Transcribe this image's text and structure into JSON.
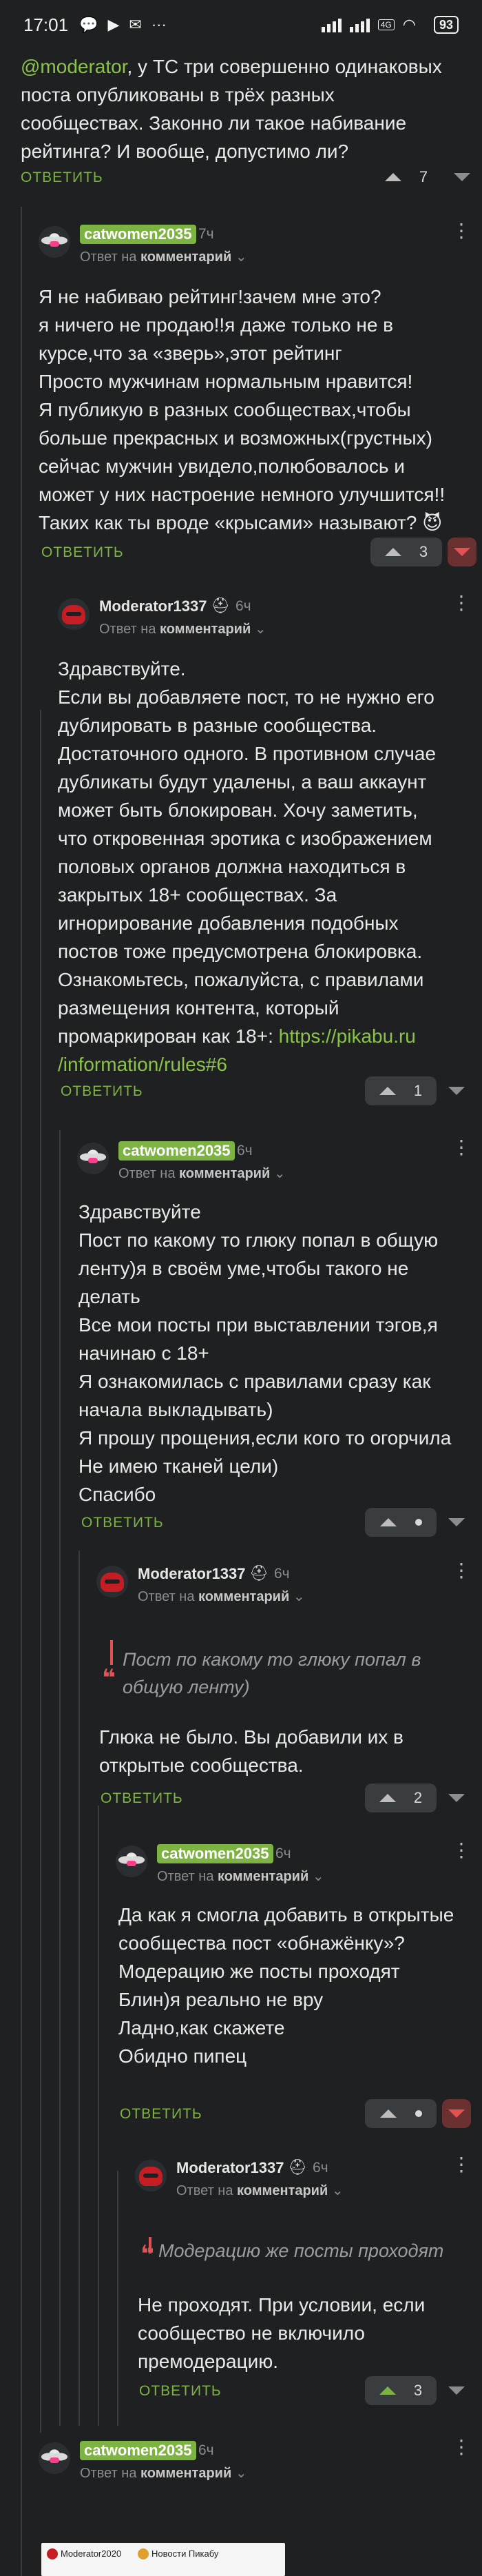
{
  "status_bar": {
    "time": "17:01",
    "icons": [
      "chat-bubble-icon",
      "youtube-icon",
      "mail-icon",
      "more-dots-icon"
    ],
    "battery": "93",
    "network": "4G"
  },
  "thread": [
    {
      "id": "intro",
      "mention": "@moderator",
      "text": ", у ТС три совершенно одинаковых поста опубликованы в трёх разных сообществах. Законно ли такое набивание рейтинга? И вообще, допустимо ли?",
      "reply_label": "ОТВЕТИТЬ",
      "rating": "7",
      "vote_state": "none"
    },
    {
      "id": "c1",
      "author": "catwomen2035",
      "time": "7ч",
      "reply_prefix": "Ответ на",
      "reply_target": "комментарий",
      "text": "Я не набиваю рейтинг!зачем мне это?\nя ничего не продаю!!я даже только не в курсе,что за «зверь»,этот рейтинг\nПросто мужчинам нормальным нравится!\nЯ публикую в разных сообществах,чтобы больше прекрасных и возможных(грустных) сейчас мужчин увидело,полюбовалось и может у них настроение немного улучшится!! Таких как ты вроде «крысами» называют? 😈",
      "reply_label": "ОТВЕТИТЬ",
      "rating": "3",
      "vote_state": "down"
    },
    {
      "id": "c2",
      "author": "Moderator1337",
      "time": "6ч",
      "reply_prefix": "Ответ на",
      "reply_target": "комментарий",
      "text": "Здравствуйте.\nЕсли вы добавляете пост, то не нужно его дублировать в разные сообщества. Достаточного одного. В противном случае дубликаты будут удалены, а ваш аккаунт может быть блокирован. Хочу заметить, что откровенная эротика с изображением половых органов должна находиться в закрытых 18+ сообществах. За игнорирование добавления подобных постов тоже предусмотрена блокировка. Ознакомьтесь, пожалуйста, с правилами размещения контента, который промаркирован как 18+: ",
      "link": "https://pikabu.ru\n/information/rules#6",
      "reply_label": "ОТВЕТИТЬ",
      "rating": "1",
      "vote_state": "none"
    },
    {
      "id": "c3",
      "author": "catwomen2035",
      "time": "6ч",
      "reply_prefix": "Ответ на",
      "reply_target": "комментарий",
      "text": "Здравствуйте\nПост по какому то глюку попал в общую ленту)я в своём уме,чтобы такого не делать\nВсе мои посты при выставлении тэгов,я начинаю с 18+\nЯ ознакомилась с правилами сразу как начала выкладывать)\nЯ прошу прощения,если кого то огорчила\nНе имею тканей цели)\nСпасибо",
      "reply_label": "ОТВЕТИТЬ",
      "rating": "•",
      "vote_state": "none"
    },
    {
      "id": "c4",
      "author": "Moderator1337",
      "time": "6ч",
      "reply_prefix": "Ответ на",
      "reply_target": "комментарий",
      "quote": "Пост по какому то глюку попал в\nобщую ленту)",
      "text": "Глюка не было. Вы добавили их в открытые сообщества.",
      "reply_label": "ОТВЕТИТЬ",
      "rating": "2",
      "vote_state": "none"
    },
    {
      "id": "c5",
      "author": "catwomen2035",
      "time": "6ч",
      "reply_prefix": "Ответ на",
      "reply_target": "комментарий",
      "text": "Да как я смогла добавить в открытые сообщества пост «обнажёнку»?\nМодерацию же посты проходят\nБлин)я реально не вру\nЛадно,как скажете\nОбидно пипец",
      "reply_label": "ОТВЕТИТЬ",
      "rating": "•",
      "vote_state": "down"
    },
    {
      "id": "c6",
      "author": "Moderator1337",
      "time": "6ч",
      "reply_prefix": "Ответ на",
      "reply_target": "комментарий",
      "quote": "Модерацию же посты проходят",
      "text": "Не проходят. При условии, если сообщество не включило премодерацию.",
      "reply_label": "ОТВЕТИТЬ",
      "rating": "3",
      "vote_state": "up"
    },
    {
      "id": "c7",
      "author": "catwomen2035",
      "time": "6ч",
      "reply_prefix": "Ответ на",
      "reply_target": "комментарий",
      "preview_items": [
        "Moderator2020",
        "Новости Пикабу"
      ]
    }
  ],
  "colors": {
    "background": "#1e2021",
    "accent_green": "#7cb342",
    "quote_red": "#e35252",
    "muted": "#8a8d90"
  }
}
